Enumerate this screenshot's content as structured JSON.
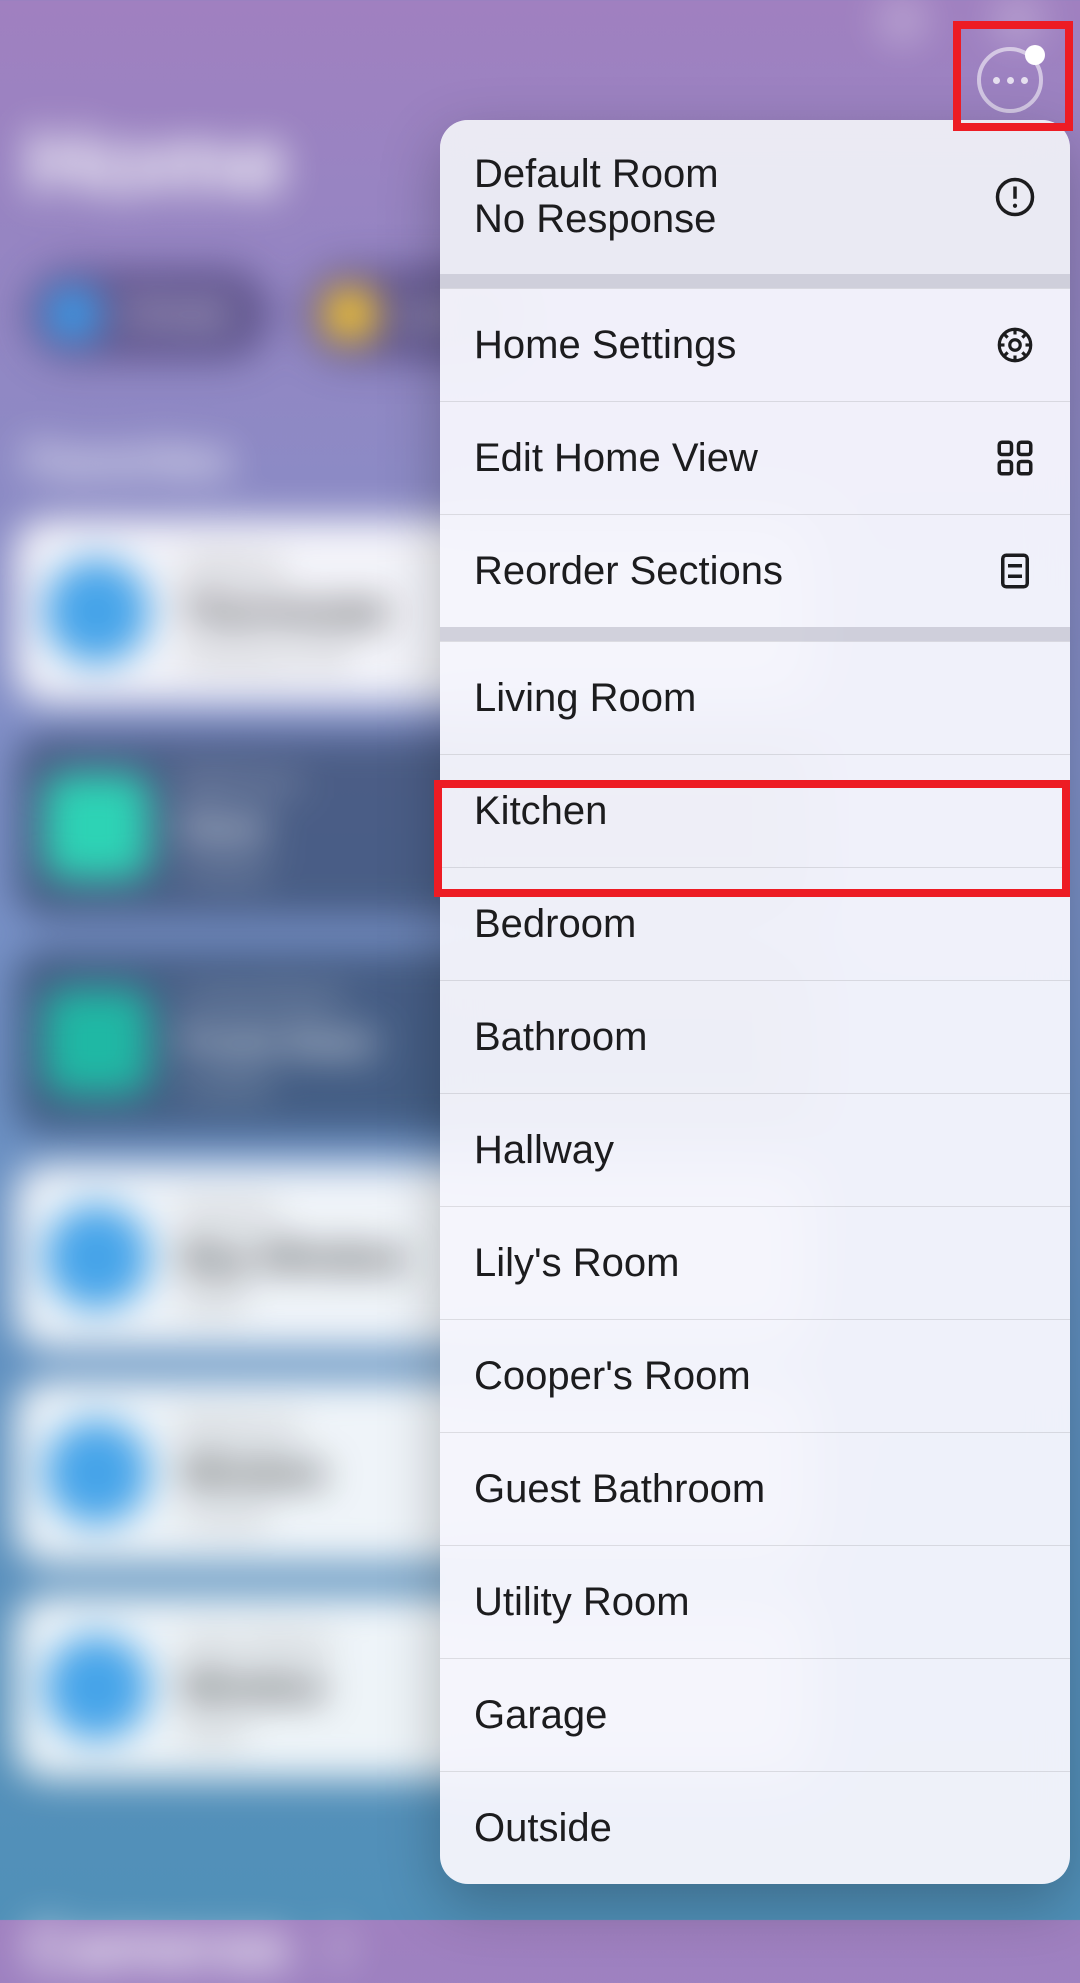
{
  "bg": {
    "title": "Home",
    "section_favorites": "Favorites",
    "section_cameras": "Cameras"
  },
  "menu": {
    "header": {
      "line1": "Default Room",
      "line2": "No Response"
    },
    "settings": [
      {
        "label": "Home Settings",
        "icon": "gear"
      },
      {
        "label": "Edit Home View",
        "icon": "grid"
      },
      {
        "label": "Reorder Sections",
        "icon": "list"
      }
    ],
    "rooms": [
      "Living Room",
      "Kitchen",
      "Bedroom",
      "Bathroom",
      "Hallway",
      "Lily's Room",
      "Cooper's Room",
      "Guest Bathroom",
      "Utility Room",
      "Garage",
      "Outside"
    ]
  }
}
